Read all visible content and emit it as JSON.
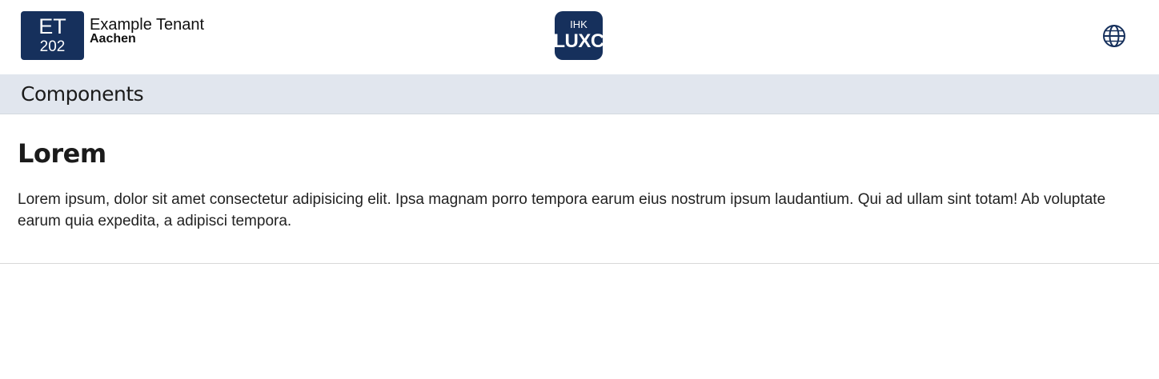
{
  "header": {
    "tenant": {
      "badge_code": "ET",
      "badge_number": "202",
      "name": "Example Tenant",
      "city": "Aachen"
    },
    "app_logo": {
      "small_text": "IHK",
      "big_text": "LUXC"
    },
    "language_icon": "globe-icon"
  },
  "subbar": {
    "title": "Components"
  },
  "main": {
    "heading": "Lorem",
    "paragraph": "Lorem ipsum, dolor sit amet consectetur adipisicing elit. Ipsa magnam porro tempora earum eius nostrum ipsum laudantium. Qui ad ullam sint totam! Ab voluptate earum quia expedita, a adipisci tempora."
  },
  "colors": {
    "brand_navy": "#16305c",
    "subbar_bg": "#e1e6ee"
  }
}
